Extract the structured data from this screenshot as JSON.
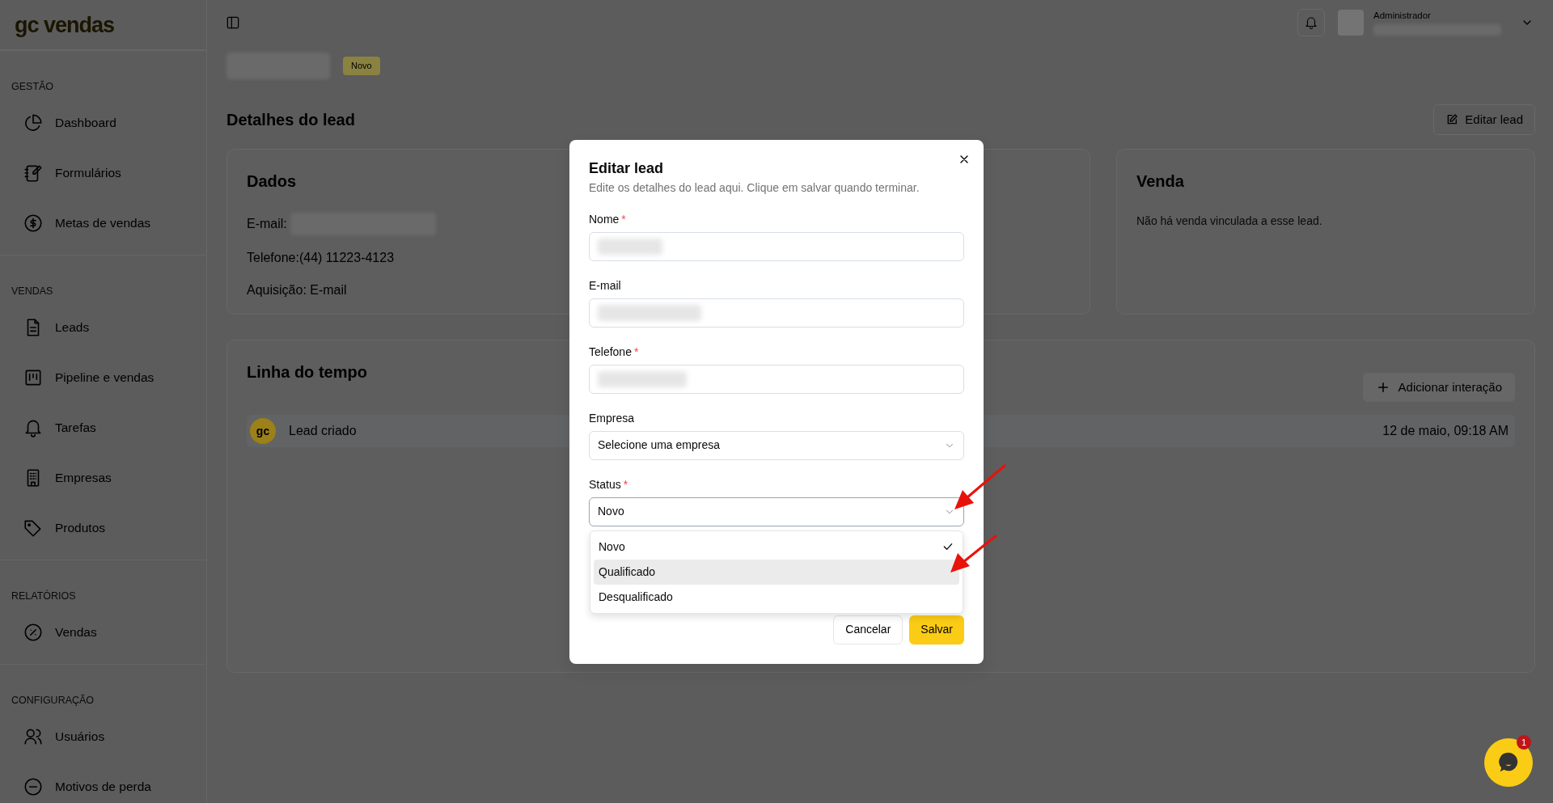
{
  "sidebar": {
    "logo": "gc vendas",
    "sections": [
      {
        "title": "GESTÃO",
        "items": [
          {
            "label": "Dashboard"
          },
          {
            "label": "Formulários"
          },
          {
            "label": "Metas de vendas"
          }
        ]
      },
      {
        "title": "VENDAS",
        "items": [
          {
            "label": "Leads"
          },
          {
            "label": "Pipeline e vendas"
          },
          {
            "label": "Tarefas"
          },
          {
            "label": "Empresas"
          },
          {
            "label": "Produtos"
          }
        ]
      },
      {
        "title": "RELATÓRIOS",
        "items": [
          {
            "label": "Vendas"
          }
        ]
      },
      {
        "title": "CONFIGURAÇÃO",
        "items": [
          {
            "label": "Usuários"
          },
          {
            "label": "Motivos de perda"
          }
        ]
      }
    ]
  },
  "header": {
    "user_role": "Administrador"
  },
  "page": {
    "status_badge": "Novo",
    "section_title": "Detalhes do lead",
    "edit_button": "Editar lead"
  },
  "dados": {
    "title": "Dados",
    "email_label": "E-mail:",
    "lines": [
      "Telefone:(44) 11223-4123",
      "Aquisição: E-mail"
    ]
  },
  "venda": {
    "title": "Venda",
    "empty_text": "Não há venda vinculada a esse lead."
  },
  "timeline": {
    "title": "Linha do tempo",
    "add_button": "Adicionar interação",
    "events": [
      {
        "avatar": "gc",
        "text": "Lead criado",
        "time": "12 de maio, 09:18 AM"
      }
    ]
  },
  "modal": {
    "title": "Editar lead",
    "description": "Edite os detalhes do lead aqui. Clique em salvar quando terminar.",
    "required_mark": "*",
    "fields": [
      {
        "kind": "text",
        "label": "Nome",
        "required": true
      },
      {
        "kind": "text",
        "label": "E-mail",
        "required": false
      },
      {
        "kind": "text",
        "label": "Telefone",
        "required": true
      },
      {
        "kind": "select",
        "label": "Empresa",
        "required": false,
        "placeholder": "Selecione uma empresa",
        "open": false
      },
      {
        "kind": "select",
        "label": "Status",
        "required": true,
        "value": "Novo",
        "open": true,
        "options": [
          {
            "label": "Novo",
            "selected": true,
            "hovered": false
          },
          {
            "label": "Qualificado",
            "selected": false,
            "hovered": true
          },
          {
            "label": "Desqualificado",
            "selected": false,
            "hovered": false
          }
        ]
      }
    ],
    "cancel_button": "Cancelar",
    "save_button": "Salvar"
  },
  "chat": {
    "badge": "1"
  }
}
